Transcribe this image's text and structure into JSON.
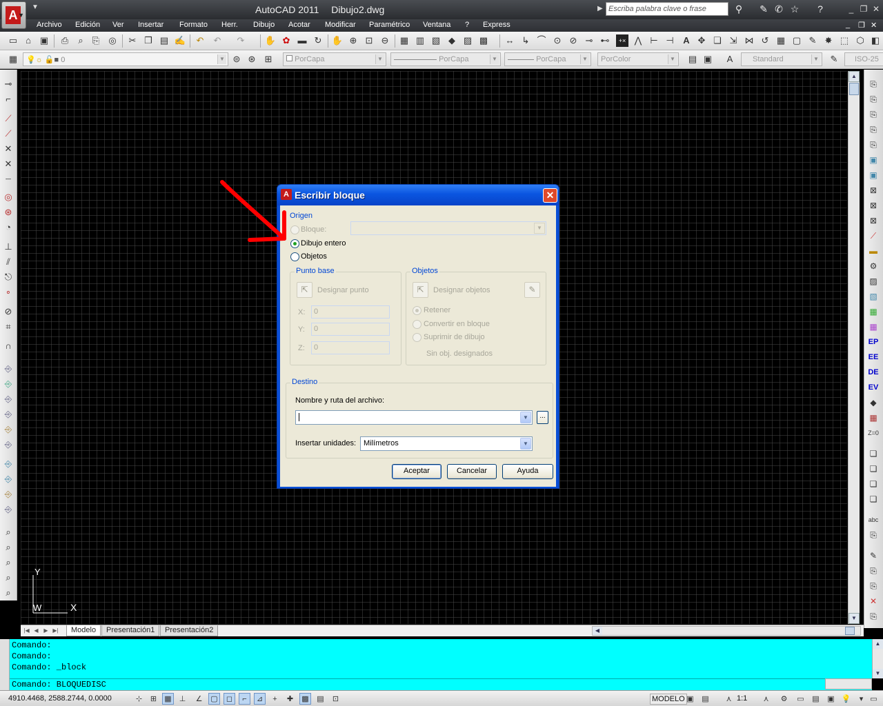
{
  "window": {
    "app_name": "AutoCAD 2011",
    "file_name": "Dibujo2.dwg",
    "search_placeholder": "Escriba palabra clave o frase"
  },
  "menu": [
    "Archivo",
    "Edición",
    "Ver",
    "Insertar",
    "Formato",
    "Herr.",
    "Dibujo",
    "Acotar",
    "Modificar",
    "Paramétrico",
    "Ventana",
    "?",
    "Express"
  ],
  "properties_toolbar": {
    "layer_value": "0",
    "color_value": "PorCapa",
    "linetype_value": "PorCapa",
    "lineweight_value": "PorCapa",
    "plotstyle_value": "PorColor",
    "text_style": "Standard",
    "dim_style": "ISO-25"
  },
  "dialog": {
    "title": "Escribir bloque",
    "origen": {
      "label": "Origen",
      "options": [
        {
          "label": "Bloque:",
          "checked": false,
          "enabled": false
        },
        {
          "label": "Dibujo entero",
          "checked": true,
          "enabled": true
        },
        {
          "label": "Objetos",
          "checked": false,
          "enabled": true
        }
      ]
    },
    "punto_base": {
      "label": "Punto base",
      "pick_label": "Designar punto",
      "x_label": "X:",
      "x_value": "0",
      "y_label": "Y:",
      "y_value": "0",
      "z_label": "Z:",
      "z_value": "0"
    },
    "objetos": {
      "label": "Objetos",
      "select_label": "Designar objetos",
      "options": [
        {
          "label": "Retener",
          "checked": true
        },
        {
          "label": "Convertir en bloque",
          "checked": false
        },
        {
          "label": "Suprimir de dibujo",
          "checked": false
        }
      ],
      "status": "Sin obj. designados"
    },
    "destino": {
      "label": "Destino",
      "file_label": "Nombre y ruta del archivo:",
      "file_value": "",
      "browse_label": "...",
      "units_label": "Insertar unidades:",
      "units_value": "Milímetros"
    },
    "buttons": {
      "ok": "Aceptar",
      "cancel": "Cancelar",
      "help": "Ayuda"
    }
  },
  "tabs": [
    "Modelo",
    "Presentación1",
    "Presentación2"
  ],
  "command_history": [
    "Comando:",
    "Comando:",
    "Comando: _block"
  ],
  "command_line": "Comando: BLOQUEDISC",
  "status": {
    "coordinates": "4910.4468, 2588.2744, 0.0000",
    "space": "MODELO",
    "scale": "1:1"
  },
  "ucs": {
    "y_label": "Y",
    "x_label": "X",
    "w_label": "W"
  },
  "colors": {
    "canvas_bg": "#000000",
    "command_bg": "#00ffff",
    "dialog_title": "#0a55e0",
    "group_label": "#0046d5",
    "annotation_arrow": "#ff0000"
  }
}
